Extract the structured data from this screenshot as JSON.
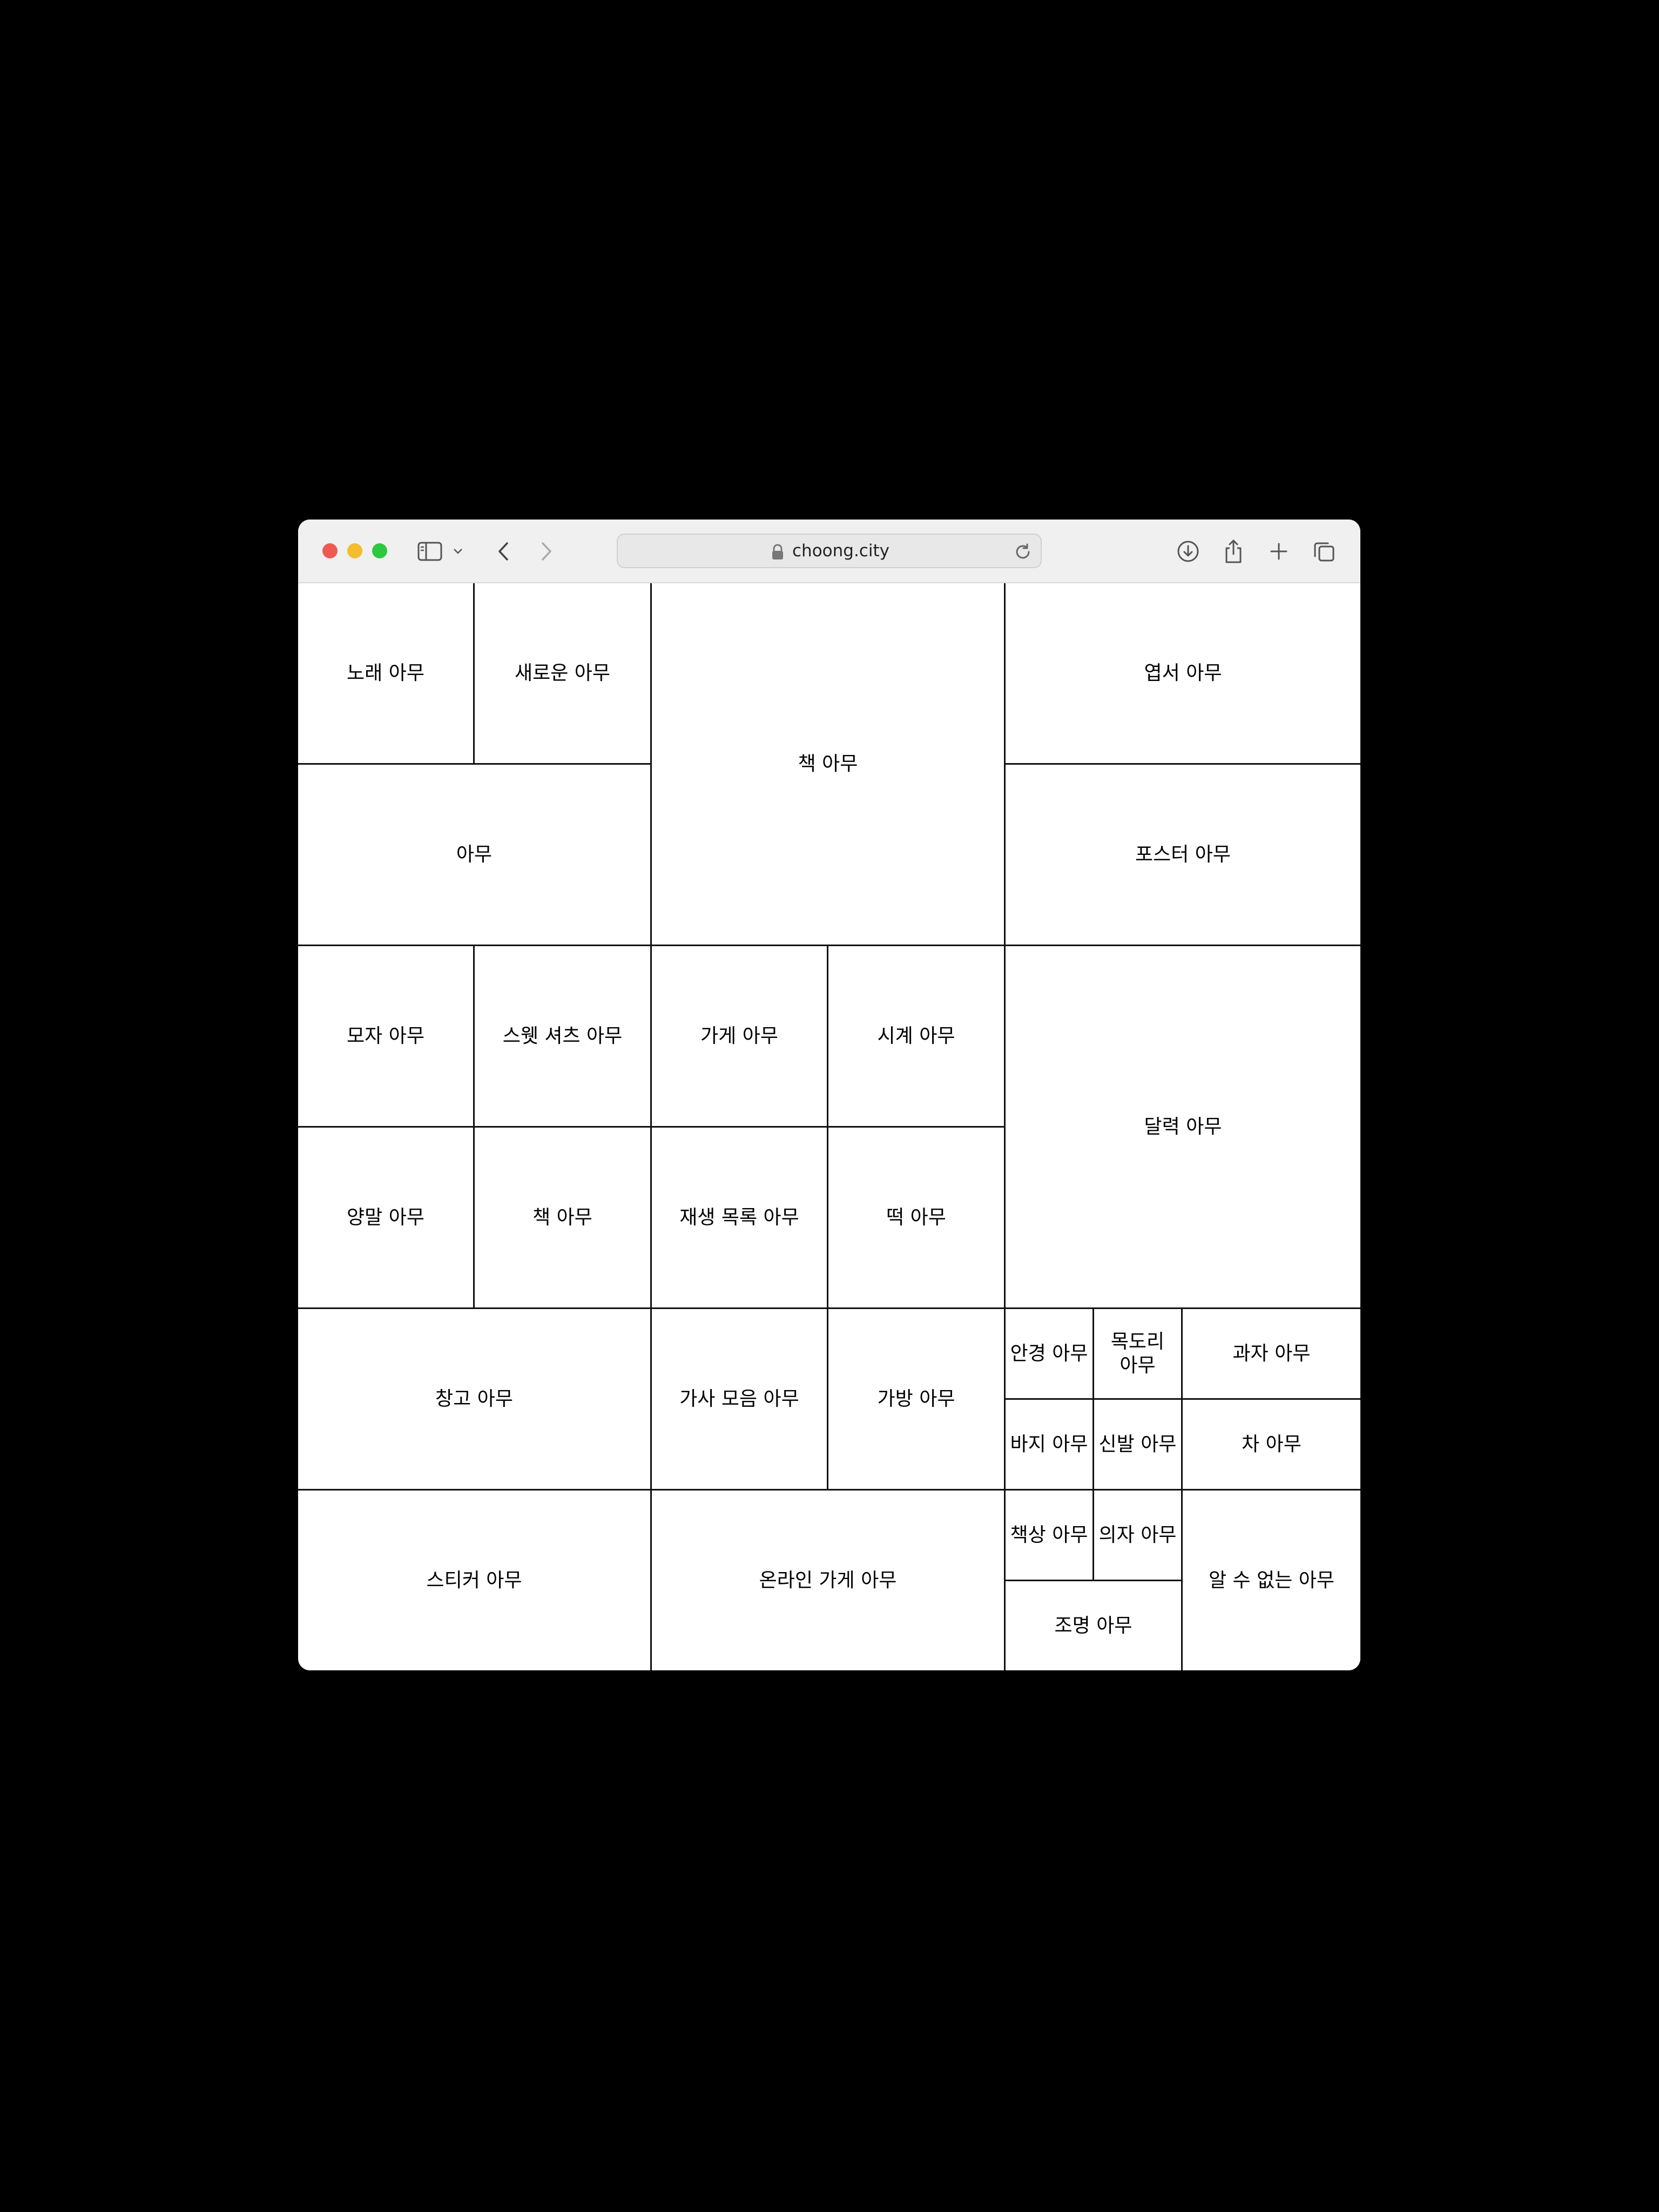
{
  "browser": {
    "url": "choong.city"
  },
  "cells": {
    "c01": "노래 아무",
    "c02": "새로운 아무",
    "c03": "책 아무",
    "c04": "엽서 아무",
    "c05": "아무",
    "c06": "포스터 아무",
    "c07": "모자 아무",
    "c08": "스웻 셔츠 아무",
    "c09": "가게 아무",
    "c10": "시계 아무",
    "c11": "달력 아무",
    "c12": "양말 아무",
    "c13": "책 아무",
    "c14": "재생 목록 아무",
    "c15": "떡 아무",
    "c16": "창고 아무",
    "c17": "가사 모음 아무",
    "c18": "가방 아무",
    "c19": "안경 아무",
    "c20": "목도리 아무",
    "c21": "과자 아무",
    "c22": "바지 아무",
    "c23": "신발 아무",
    "c24": "차 아무",
    "c25": "스티커 아무",
    "c26": "온라인 가게 아무",
    "c27": "책상 아무",
    "c28": "의자 아무",
    "c29": "알 수 없는 아무",
    "c30": "조명 아무"
  }
}
